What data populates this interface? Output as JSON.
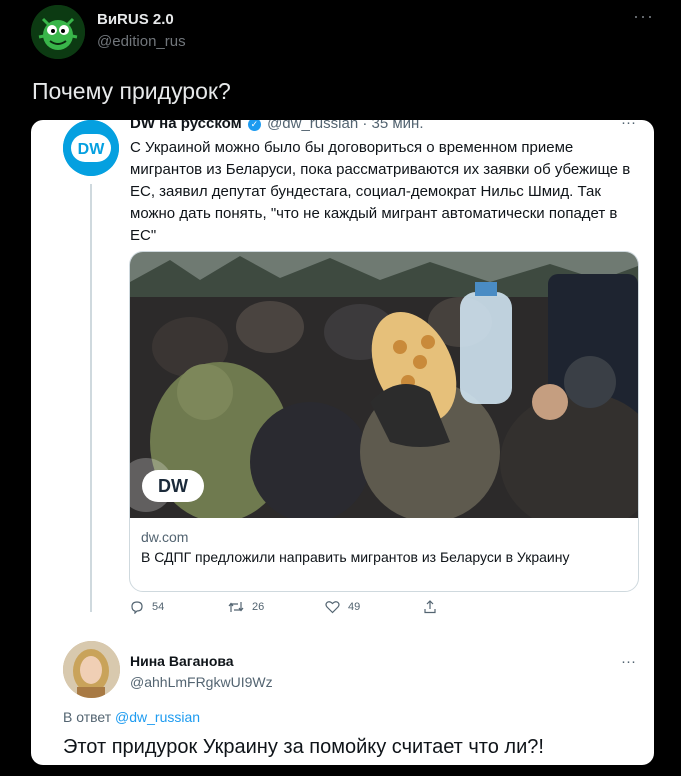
{
  "post": {
    "author_name": "ВиRUS 2.0",
    "author_handle": "@edition_rus",
    "more": "···",
    "text": "Почему придурок?"
  },
  "quoted": {
    "author_name": "DW на русском",
    "author_handle": "@dw_russian · 35 мин.",
    "more": "···",
    "text": "С Украиной можно было бы договориться о временном приеме мигрантов из Беларуси, пока рассматриваются их заявки об убежище в ЕС, заявил депутат бундестага, социал-демократ Нильс Шмид. Так можно дать понять, \"что не каждый мигрант автоматически попадет в ЕС\"",
    "avatar_logo": "DW",
    "link": {
      "domain": "dw.com",
      "title": "В СДПГ предложили направить мигрантов из Беларуси в Украину",
      "photo_logo": "DW"
    },
    "actions": {
      "replies": "54",
      "retweets": "26",
      "likes": "49"
    }
  },
  "reply": {
    "author_name": "Нина Ваганова",
    "author_handle": "@ahhLmFRgkwUI9Wz",
    "more": "···",
    "reply_to_prefix": "В ответ",
    "reply_to_handle": "@dw_russian",
    "text": "Этот придурок Украину за помойку считает что ли?!"
  },
  "colors": {
    "background": "#000000",
    "accent": "#1d9bf0",
    "dw_blue": "#05a0e0"
  }
}
